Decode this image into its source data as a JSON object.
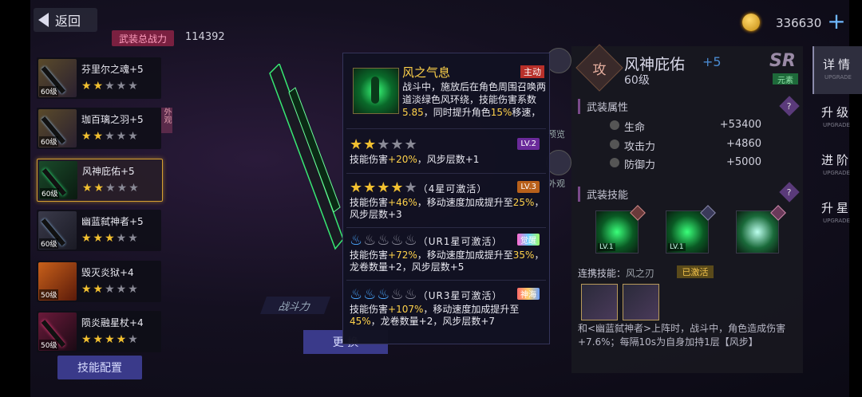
{
  "top": {
    "back_label": "返回",
    "power_label": "武装总战力",
    "power_value": "114392",
    "currency_value": "336630",
    "plus": "+"
  },
  "weapons": [
    {
      "name": "芬里尔之魂+5",
      "level": "60级",
      "stars_on": 2,
      "stars_total": 5,
      "selected": false,
      "tag": ""
    },
    {
      "name": "珈百璃之羽+5",
      "level": "60级",
      "stars_on": 2,
      "stars_total": 5,
      "selected": false,
      "tag": "外观"
    },
    {
      "name": "风神庇佑+5",
      "level": "60级",
      "stars_on": 2,
      "stars_total": 5,
      "selected": true,
      "tag": ""
    },
    {
      "name": "幽蓝弑神者+5",
      "level": "60级",
      "stars_on": 3,
      "stars_total": 5,
      "selected": false,
      "tag": ""
    },
    {
      "name": "毁灭炎狱+4",
      "level": "50级",
      "stars_on": 2,
      "stars_total": 5,
      "selected": false,
      "tag": ""
    },
    {
      "name": "陨炎融星杖+4",
      "level": "50级",
      "stars_on": 4,
      "stars_total": 5,
      "selected": false,
      "tag": ""
    }
  ],
  "skill_config_label": "技能配置",
  "zhandouli_label": "战斗力",
  "change_label": "更 换",
  "side_labels": {
    "preview": "预览",
    "appearance": "外观"
  },
  "popup": {
    "title": "风之气息",
    "main_tag": "主动",
    "desc_a": "战斗中，施放后在角色周围召唤两道淡绿色风环绕，技能伤害系数",
    "desc_h1": "5.85",
    "desc_b": "，同时提升角色",
    "desc_h2": "15%",
    "desc_c": "移速，",
    "tiers": [
      {
        "badge": "LV.2",
        "stars_on": 2,
        "cond": "",
        "t1": "技能伤害",
        "h1": "+20%",
        "t2": "，风步层数+1",
        "h2": "",
        "t3": ""
      },
      {
        "badge": "LV.3",
        "stars_on": 4,
        "cond": "（4星可激活）",
        "t1": "技能伤害",
        "h1": "+46%",
        "t2": "，移动速度加成提升至",
        "h2": "25%",
        "t3": "，风步层数+3"
      },
      {
        "badge": "觉醒",
        "flames_on": 1,
        "cond": "（UR1星可激活）",
        "t1": "技能伤害",
        "h1": "+72%",
        "t2": "，移动速度加成提升至",
        "h2": "35%",
        "t3": "，龙卷数量+2，风步层数+5"
      },
      {
        "badge": "神海",
        "flames_on": 3,
        "cond": "（UR3星可激活）",
        "t1": "技能伤害",
        "h1": "+107%",
        "t2": "，移动速度加成提升至",
        "h2": "45%",
        "t3": "，龙卷数量+2，风步层数+7"
      }
    ]
  },
  "detail": {
    "type_tag": "攻",
    "name": "风神庇佑",
    "plus": "+5",
    "level": "60级",
    "rarity": "SR",
    "element": "元素",
    "attr_title": "武装属性",
    "attrs": [
      {
        "label": "生命",
        "value": "+53400"
      },
      {
        "label": "攻击力",
        "value": "+4860"
      },
      {
        "label": "防御力",
        "value": "+5000"
      }
    ],
    "skill_title": "武装技能",
    "skill_lv": "LV.1",
    "combo_label": "连携技能：",
    "combo_name": "风之刃",
    "combo_status": "已激活",
    "combo_desc": "和<幽蓝弑神者>上阵时，战斗中，角色造成伤害+7.6%；每隔10s为自身加持1层【风步】"
  },
  "tabs": [
    {
      "cn": "详情",
      "en": "UPGRADE"
    },
    {
      "cn": "升级",
      "en": "UPGRADE"
    },
    {
      "cn": "进阶",
      "en": "UPGRADE"
    },
    {
      "cn": "升星",
      "en": "UPGRADE"
    }
  ],
  "colors": {
    "accent_gold": "#ffd24a",
    "button_blue": "#3a3a8a",
    "star": "#f2c030"
  }
}
